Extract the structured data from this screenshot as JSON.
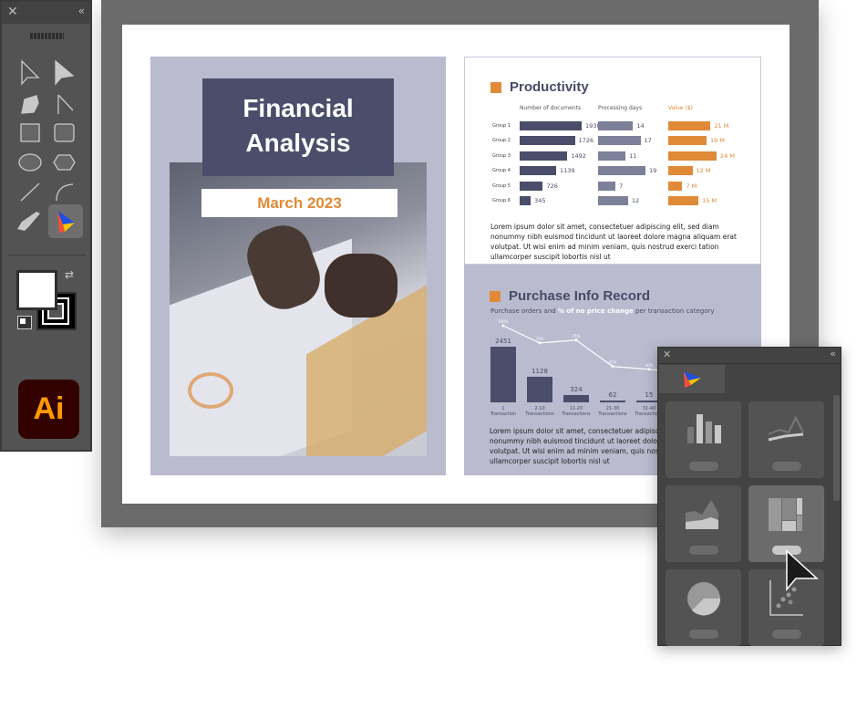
{
  "cover": {
    "title_line1": "Financial",
    "title_line2": "Analysis",
    "date": "March 2023"
  },
  "productivity": {
    "title": "Productivity",
    "columns": [
      "Number of documents",
      "Processing days",
      "Value ($)"
    ],
    "groups": [
      "Group 1",
      "Group 2",
      "Group 3",
      "Group 4",
      "Group 5",
      "Group 6"
    ],
    "documents": [
      1938,
      1726,
      1492,
      1139,
      726,
      345
    ],
    "days": [
      14,
      17,
      11,
      19,
      7,
      12
    ],
    "value_labels": [
      "21 M",
      "19 M",
      "24 M",
      "12 M",
      "7 M",
      "15 M"
    ],
    "values": [
      21,
      19,
      24,
      12,
      7,
      15
    ],
    "text": "Lorem ipsum dolor sit amet, consectetuer adipiscing elit, sed diam nonummy nibh euismod tincidunt ut laoreet dolore magna aliquam erat volutpat. Ut wisi enim ad minim veniam, quis nostrud exerci tation ullamcorper suscipit lobortis nisl ut"
  },
  "purchase": {
    "title": "Purchase Info Record",
    "subtitle_a": "Purchase orders and ",
    "subtitle_b": "% of no price change",
    "subtitle_c": " per transaction category",
    "categories": [
      "1 Transaction",
      "2-10 Transactions",
      "11-20 Transactions",
      "21-30 Transactions",
      "31-40 Transactions"
    ],
    "orders": [
      2451,
      1128,
      324,
      62,
      15
    ],
    "pct_labels": [
      "100%",
      "70%",
      "75%",
      "45%",
      "40%"
    ],
    "pct": [
      100,
      70,
      75,
      45,
      40
    ],
    "text": "Lorem ipsum dolor sit amet, consectetuer adipiscing elit, sed diam nonummy nibh euismod tincidunt ut laoreet dolore magna aliquam erat volutpat. Ut wisi enim ad minim veniam, quis nostrud exerci tation ullamcorper suscipit lobortis nisl ut"
  },
  "toolbar": {
    "app_logo": "Ai",
    "tools": [
      "selection-tool",
      "direct-selection-tool",
      "blob-brush-tool",
      "pen-tool",
      "rectangle-tool",
      "rounded-rectangle-tool",
      "ellipse-tool",
      "polygon-tool",
      "line-tool",
      "arc-tool",
      "paintbrush-tool",
      "chart-plugin-tool"
    ]
  },
  "panel": {
    "charts": [
      "bar-chart",
      "line-chart",
      "area-chart",
      "treemap-chart",
      "pie-chart",
      "scatter-chart"
    ]
  },
  "colors": {
    "accent": "#e08a38",
    "navy": "#4a4e6a",
    "slate": "#7d8099",
    "cover": "#babbcf"
  }
}
